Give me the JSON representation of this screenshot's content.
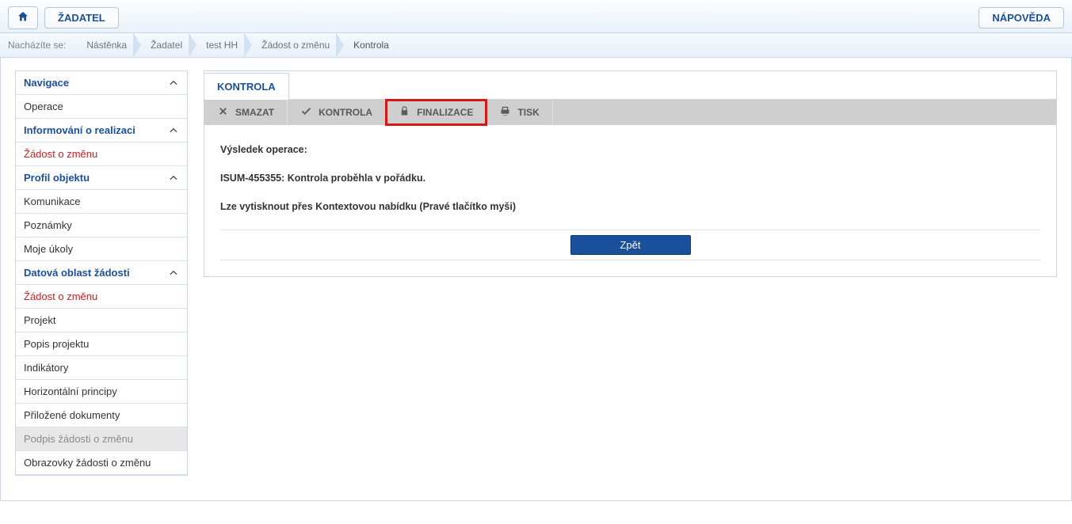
{
  "topbar": {
    "applicant_label": "ŽADATEL",
    "help_label": "NÁPOVĚDA"
  },
  "breadcrumb": {
    "prefix": "Nacházíte se:",
    "items": [
      "Nástěnka",
      "Žadatel",
      "test HH",
      "Žádost o změnu",
      "Kontrola"
    ]
  },
  "sidebar": {
    "groups": [
      {
        "title": "Navigace",
        "items": [
          {
            "label": "Operace"
          }
        ]
      },
      {
        "title": "Informování o realizaci",
        "items": [
          {
            "label": "Žádost o změnu",
            "red": true
          }
        ]
      },
      {
        "title": "Profil objektu",
        "items": [
          {
            "label": "Komunikace"
          },
          {
            "label": "Poznámky"
          },
          {
            "label": "Moje úkoly"
          }
        ]
      },
      {
        "title": "Datová oblast žádosti",
        "items": [
          {
            "label": "Žádost o změnu",
            "red": true
          },
          {
            "label": "Projekt"
          },
          {
            "label": "Popis projektu"
          },
          {
            "label": "Indikátory"
          },
          {
            "label": "Horizontální principy"
          },
          {
            "label": "Přiložené dokumenty"
          },
          {
            "label": "Podpis žádosti o změnu",
            "disabled": true
          },
          {
            "label": "Obrazovky žádosti o změnu"
          }
        ]
      }
    ]
  },
  "main": {
    "tab_label": "KONTROLA",
    "toolbar": {
      "delete": "SMAZAT",
      "check": "KONTROLA",
      "finalize": "FINALIZACE",
      "print": "TISK"
    },
    "result_label": "Výsledek operace:",
    "result_msg": "ISUM-455355: Kontrola proběhla v pořádku.",
    "print_hint": "Lze vytisknout přes Kontextovou nabídku (Pravé tlačítko myši)",
    "back_label": "Zpět"
  }
}
